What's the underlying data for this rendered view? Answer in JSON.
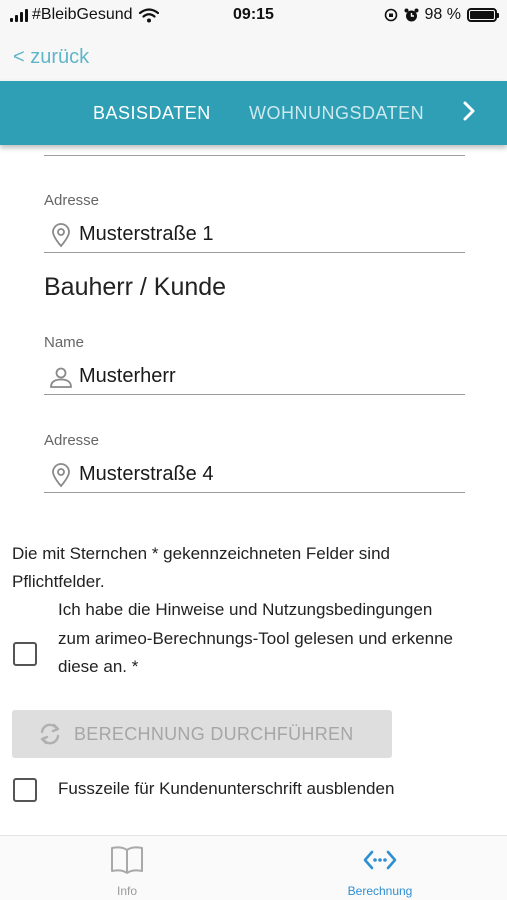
{
  "status_bar": {
    "carrier": "#BleibGesund",
    "time": "09:15",
    "battery_percent": "98 %",
    "battery_level": 0.98
  },
  "nav": {
    "back_label": "< zurück"
  },
  "tabs": [
    {
      "label": "BASISDATEN",
      "active": true
    },
    {
      "label": "WOHNUNGSDATEN",
      "active": false
    }
  ],
  "form": {
    "object_address": {
      "label": "Adresse",
      "value": "Musterstraße 1",
      "icon": "location-pin-icon"
    },
    "client_section_title": "Bauherr / Kunde",
    "client_name": {
      "label": "Name",
      "value": "Musterherr",
      "icon": "person-icon"
    },
    "client_address": {
      "label": "Adresse",
      "value": "Musterstraße 4",
      "icon": "location-pin-icon"
    }
  },
  "required_note": "Die mit Sternchen * gekennzeichneten Felder sind Pflichtfelder.",
  "consent": {
    "checked": false,
    "text": "Ich habe die Hinweise und Nutzungsbedingungen zum arimeo-Berechnungs-Tool gelesen und erkenne diese an. *"
  },
  "calc_button": {
    "label": "BERECHNUNG DURCHFÜHREN",
    "enabled": false,
    "icon": "refresh-icon"
  },
  "footer_toggle": {
    "checked": false,
    "text": "Fusszeile für Kundenunterschrift ausblenden"
  },
  "bottom_nav": [
    {
      "label": "Info",
      "icon": "book-icon",
      "active": false
    },
    {
      "label": "Berechnung",
      "icon": "code-arrows-icon",
      "active": true
    }
  ],
  "colors": {
    "primary": "#2e9fb4",
    "accent_link": "#5fb6c8",
    "active_nav": "#2e8fd1",
    "tab_indicator": "#e8663a"
  }
}
